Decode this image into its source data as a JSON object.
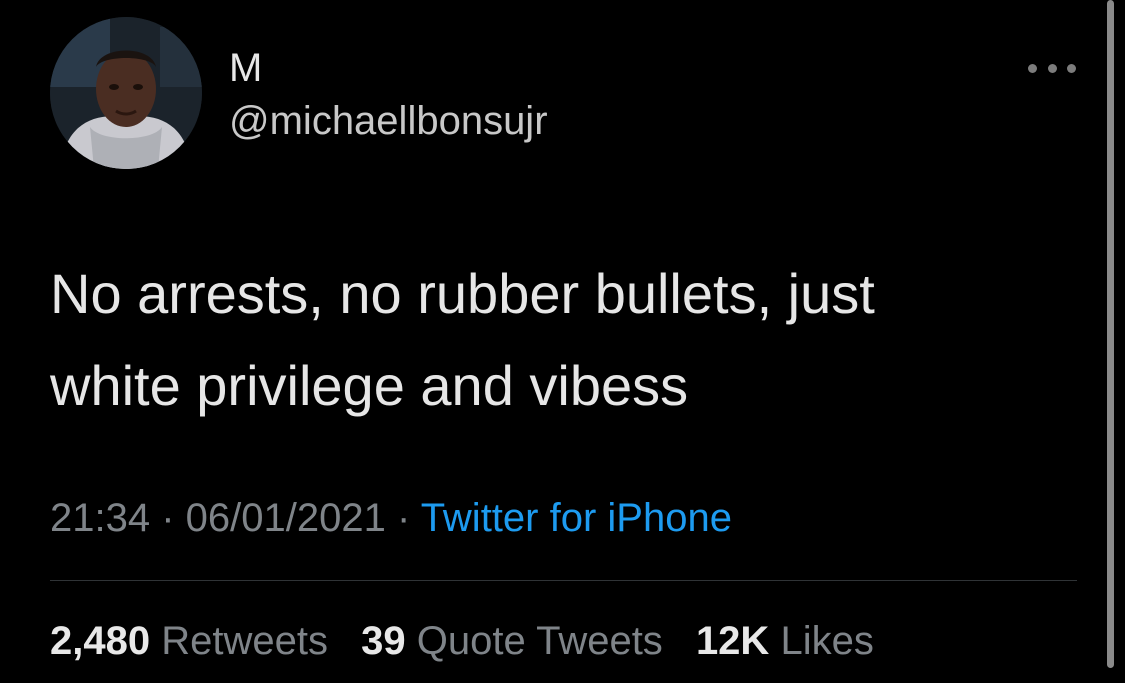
{
  "user": {
    "display_name": "M",
    "handle": "@michaellbonsujr"
  },
  "header": {
    "more_icon": "more-horizontal-icon"
  },
  "tweet": {
    "text_line1": "No arrests, no rubber bullets, just",
    "text_line2": "white privilege and vibess"
  },
  "meta": {
    "time": "21:34",
    "separator1": " · ",
    "date": "06/01/2021",
    "separator2": " · ",
    "source": "Twitter for iPhone"
  },
  "stats": {
    "retweets_count": "2,480",
    "retweets_label": "Retweets",
    "quotes_count": "39",
    "quotes_label": "Quote Tweets",
    "likes_count": "12K",
    "likes_label": "Likes"
  },
  "colors": {
    "background": "#000000",
    "link": "#1d9bf0",
    "muted": "#7f8489",
    "text": "#e6e6e6"
  }
}
